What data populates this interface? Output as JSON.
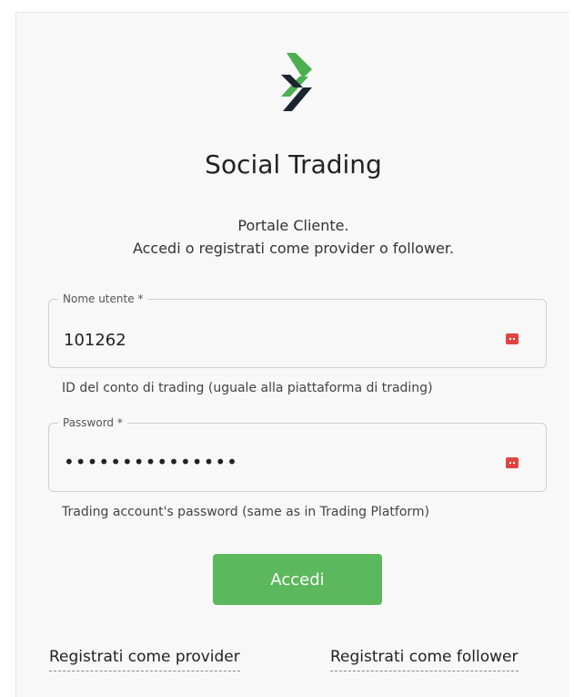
{
  "header": {
    "title": "Social Trading",
    "subtitle_line1": "Portale Cliente.",
    "subtitle_line2": "Accedi o registrati come provider o follower."
  },
  "form": {
    "username": {
      "label": "Nome utente *",
      "value": "101262",
      "hint": "ID del conto di trading (uguale alla piattaforma di trading)",
      "icon": "password-manager-icon"
    },
    "password": {
      "label": "Password *",
      "value": "•••••••••••••••",
      "hint": "Trading account's password (same as in Trading Platform)",
      "icon": "password-manager-icon"
    },
    "submit_label": "Accedi"
  },
  "links": {
    "register_provider": "Registrati come provider",
    "register_follower": "Registrati come follower"
  },
  "colors": {
    "accent_green": "#5cb85c",
    "logo_green": "#4caf50",
    "logo_dark": "#1c2331",
    "icon_red": "#e0453f"
  }
}
